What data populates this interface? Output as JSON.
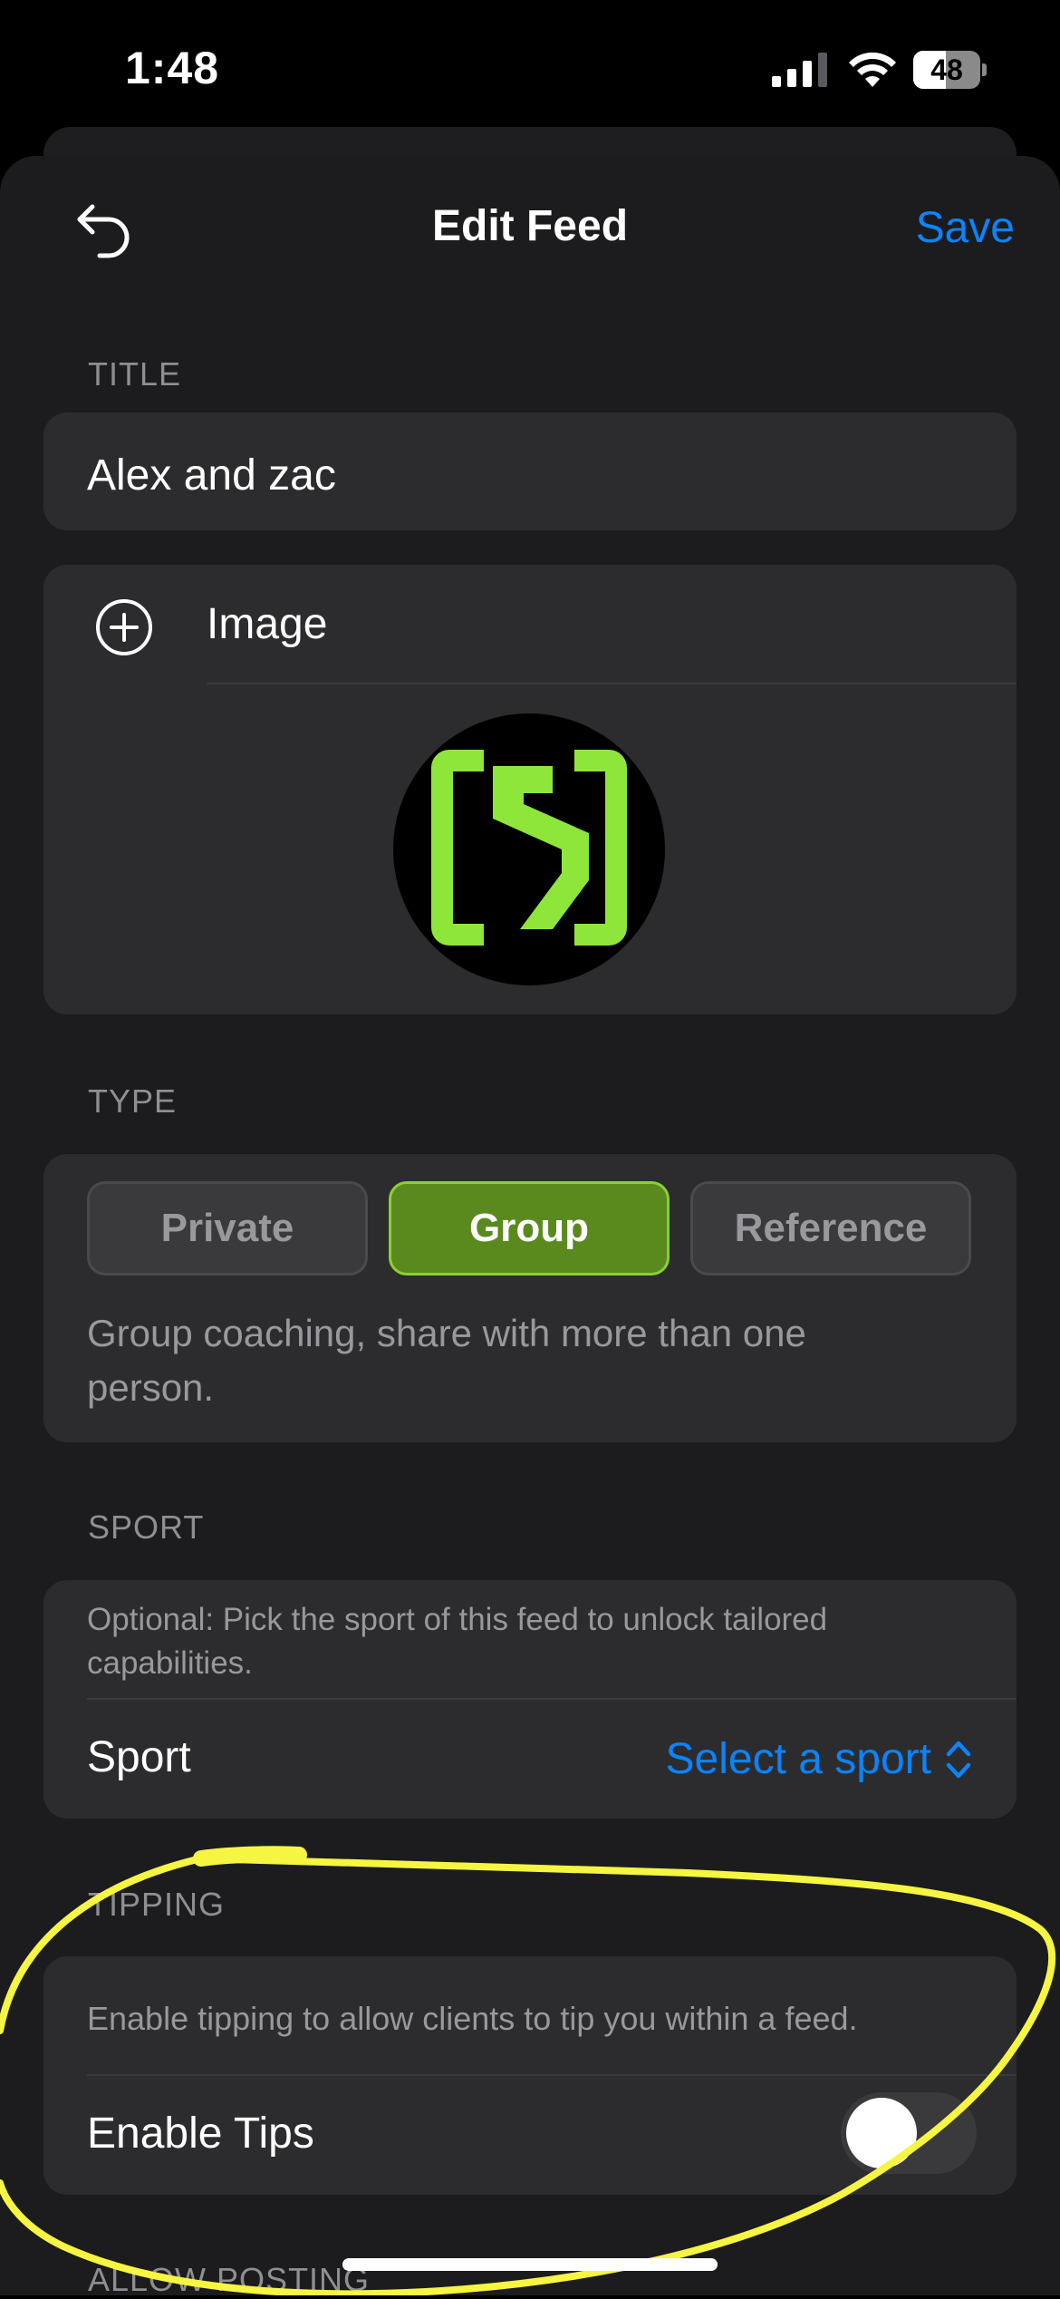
{
  "status_bar": {
    "time": "1:48",
    "battery_level": "48",
    "icons": [
      "cellular-signal-icon",
      "wifi-icon",
      "battery-icon"
    ]
  },
  "header": {
    "title": "Edit Feed",
    "save_label": "Save",
    "back_icon": "undo-arrow-icon"
  },
  "title_section": {
    "label": "TITLE",
    "value": "Alex and zac"
  },
  "image_section": {
    "label": "Image",
    "icon": "plus-circle-icon"
  },
  "type_section": {
    "label": "TYPE",
    "options": [
      "Private",
      "Group",
      "Reference"
    ],
    "selected": "Group",
    "description": "Group coaching, share with more than one person."
  },
  "sport_section": {
    "label": "SPORT",
    "description": "Optional: Pick the sport of this feed to unlock tailored capabilities.",
    "row_label": "Sport",
    "select_value": "Select a sport"
  },
  "tipping_section": {
    "label": "TIPPING",
    "description": "Enable tipping to allow clients to tip you within a feed.",
    "row_label": "Enable Tips",
    "enabled": false
  },
  "posting_section": {
    "label": "ALLOW POSTING"
  },
  "colors": {
    "accent": "#0a84ff",
    "selected_segment": "#5a8a1e",
    "logo_green": "#8ee63a",
    "annotation": "#f5f542"
  }
}
